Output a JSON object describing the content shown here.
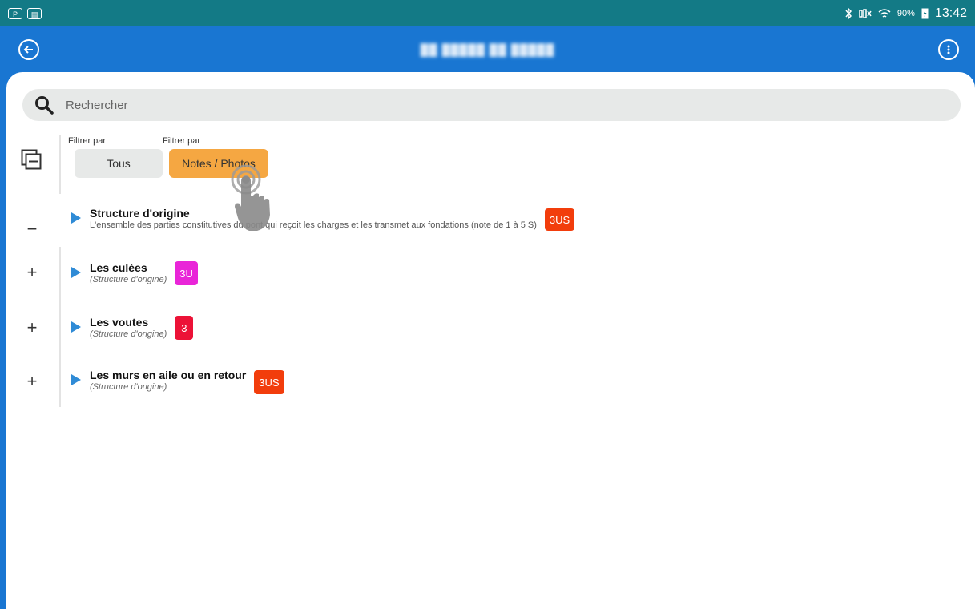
{
  "statusbar": {
    "left_icons": [
      "P",
      "▤"
    ],
    "icons": [
      "bluetooth-icon",
      "mute-icon",
      "wifi-icon",
      "battery-icon"
    ],
    "battery": "90%",
    "clock": "13:42"
  },
  "appbar": {
    "back_icon": "back-arrow-icon",
    "title": "██ █████ ██ █████",
    "more_icon": "more-options-icon"
  },
  "search": {
    "placeholder": "Rechercher",
    "value": ""
  },
  "filters": [
    {
      "label": "Filtrer par",
      "chip": "Tous"
    },
    {
      "label": "Filtrer par",
      "chip": "Notes / Photos"
    }
  ],
  "rail": {
    "collapse_icon": "collapse-all-icon",
    "toggles": [
      "−",
      "+",
      "+",
      "+"
    ]
  },
  "rows": [
    {
      "title": "Structure d'origine",
      "subtitle": "L'ensemble des parties constitutives du pont qui reçoit les charges et les transmet aux fondations (note de 1 à 5 S)",
      "badge": "3US",
      "badge_color": "#f23d0c"
    },
    {
      "title": "Les culées",
      "subtitle": "(Structure d'origine)",
      "badge": "3U",
      "badge_color": "#e925d8"
    },
    {
      "title": "Les voutes",
      "subtitle": "(Structure d'origine)",
      "badge": "3",
      "badge_color": "#ec1237"
    },
    {
      "title": "Les murs en aile ou en retour",
      "subtitle": "(Structure d'origine)",
      "badge": "3US",
      "badge_color": "#f23d0c"
    }
  ],
  "colors": {
    "statusbar": "#137a86",
    "appbar": "#1976d2",
    "accent_orange": "#f5a742",
    "play": "#2f8bd6"
  }
}
